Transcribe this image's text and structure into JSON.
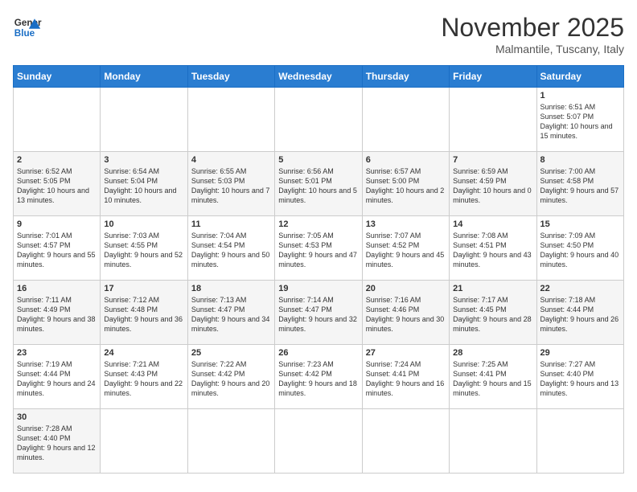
{
  "header": {
    "logo_general": "General",
    "logo_blue": "Blue",
    "month": "November 2025",
    "location": "Malmantile, Tuscany, Italy"
  },
  "days_of_week": [
    "Sunday",
    "Monday",
    "Tuesday",
    "Wednesday",
    "Thursday",
    "Friday",
    "Saturday"
  ],
  "weeks": [
    [
      {
        "day": "",
        "info": ""
      },
      {
        "day": "",
        "info": ""
      },
      {
        "day": "",
        "info": ""
      },
      {
        "day": "",
        "info": ""
      },
      {
        "day": "",
        "info": ""
      },
      {
        "day": "",
        "info": ""
      },
      {
        "day": "1",
        "info": "Sunrise: 6:51 AM\nSunset: 5:07 PM\nDaylight: 10 hours and 15 minutes."
      }
    ],
    [
      {
        "day": "2",
        "info": "Sunrise: 6:52 AM\nSunset: 5:05 PM\nDaylight: 10 hours and 13 minutes."
      },
      {
        "day": "3",
        "info": "Sunrise: 6:54 AM\nSunset: 5:04 PM\nDaylight: 10 hours and 10 minutes."
      },
      {
        "day": "4",
        "info": "Sunrise: 6:55 AM\nSunset: 5:03 PM\nDaylight: 10 hours and 7 minutes."
      },
      {
        "day": "5",
        "info": "Sunrise: 6:56 AM\nSunset: 5:01 PM\nDaylight: 10 hours and 5 minutes."
      },
      {
        "day": "6",
        "info": "Sunrise: 6:57 AM\nSunset: 5:00 PM\nDaylight: 10 hours and 2 minutes."
      },
      {
        "day": "7",
        "info": "Sunrise: 6:59 AM\nSunset: 4:59 PM\nDaylight: 10 hours and 0 minutes."
      },
      {
        "day": "8",
        "info": "Sunrise: 7:00 AM\nSunset: 4:58 PM\nDaylight: 9 hours and 57 minutes."
      }
    ],
    [
      {
        "day": "9",
        "info": "Sunrise: 7:01 AM\nSunset: 4:57 PM\nDaylight: 9 hours and 55 minutes."
      },
      {
        "day": "10",
        "info": "Sunrise: 7:03 AM\nSunset: 4:55 PM\nDaylight: 9 hours and 52 minutes."
      },
      {
        "day": "11",
        "info": "Sunrise: 7:04 AM\nSunset: 4:54 PM\nDaylight: 9 hours and 50 minutes."
      },
      {
        "day": "12",
        "info": "Sunrise: 7:05 AM\nSunset: 4:53 PM\nDaylight: 9 hours and 47 minutes."
      },
      {
        "day": "13",
        "info": "Sunrise: 7:07 AM\nSunset: 4:52 PM\nDaylight: 9 hours and 45 minutes."
      },
      {
        "day": "14",
        "info": "Sunrise: 7:08 AM\nSunset: 4:51 PM\nDaylight: 9 hours and 43 minutes."
      },
      {
        "day": "15",
        "info": "Sunrise: 7:09 AM\nSunset: 4:50 PM\nDaylight: 9 hours and 40 minutes."
      }
    ],
    [
      {
        "day": "16",
        "info": "Sunrise: 7:11 AM\nSunset: 4:49 PM\nDaylight: 9 hours and 38 minutes."
      },
      {
        "day": "17",
        "info": "Sunrise: 7:12 AM\nSunset: 4:48 PM\nDaylight: 9 hours and 36 minutes."
      },
      {
        "day": "18",
        "info": "Sunrise: 7:13 AM\nSunset: 4:47 PM\nDaylight: 9 hours and 34 minutes."
      },
      {
        "day": "19",
        "info": "Sunrise: 7:14 AM\nSunset: 4:47 PM\nDaylight: 9 hours and 32 minutes."
      },
      {
        "day": "20",
        "info": "Sunrise: 7:16 AM\nSunset: 4:46 PM\nDaylight: 9 hours and 30 minutes."
      },
      {
        "day": "21",
        "info": "Sunrise: 7:17 AM\nSunset: 4:45 PM\nDaylight: 9 hours and 28 minutes."
      },
      {
        "day": "22",
        "info": "Sunrise: 7:18 AM\nSunset: 4:44 PM\nDaylight: 9 hours and 26 minutes."
      }
    ],
    [
      {
        "day": "23",
        "info": "Sunrise: 7:19 AM\nSunset: 4:44 PM\nDaylight: 9 hours and 24 minutes."
      },
      {
        "day": "24",
        "info": "Sunrise: 7:21 AM\nSunset: 4:43 PM\nDaylight: 9 hours and 22 minutes."
      },
      {
        "day": "25",
        "info": "Sunrise: 7:22 AM\nSunset: 4:42 PM\nDaylight: 9 hours and 20 minutes."
      },
      {
        "day": "26",
        "info": "Sunrise: 7:23 AM\nSunset: 4:42 PM\nDaylight: 9 hours and 18 minutes."
      },
      {
        "day": "27",
        "info": "Sunrise: 7:24 AM\nSunset: 4:41 PM\nDaylight: 9 hours and 16 minutes."
      },
      {
        "day": "28",
        "info": "Sunrise: 7:25 AM\nSunset: 4:41 PM\nDaylight: 9 hours and 15 minutes."
      },
      {
        "day": "29",
        "info": "Sunrise: 7:27 AM\nSunset: 4:40 PM\nDaylight: 9 hours and 13 minutes."
      }
    ],
    [
      {
        "day": "30",
        "info": "Sunrise: 7:28 AM\nSunset: 4:40 PM\nDaylight: 9 hours and 12 minutes."
      },
      {
        "day": "",
        "info": ""
      },
      {
        "day": "",
        "info": ""
      },
      {
        "day": "",
        "info": ""
      },
      {
        "day": "",
        "info": ""
      },
      {
        "day": "",
        "info": ""
      },
      {
        "day": "",
        "info": ""
      }
    ]
  ]
}
